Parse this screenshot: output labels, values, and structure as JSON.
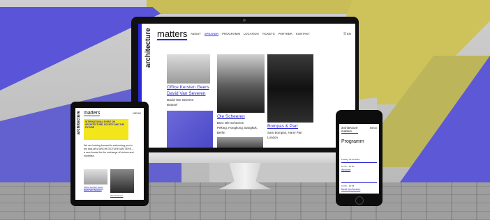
{
  "desktop": {
    "brand_vertical": "architecture",
    "brand_main": "matters",
    "nav": [
      "ABOUT",
      "SPEAKER",
      "PROGRAMM",
      "LOCATION",
      "TICKETS",
      "PARTNER",
      "KONTAKT"
    ],
    "nav_active_index": 1,
    "nav_right": "☰ EN",
    "cards": [
      {
        "title1": "Office Kersten Geers",
        "title2": "David Van Severen",
        "line1": "David Van Severen",
        "line2": "Brüssel"
      },
      {
        "title1": "Ole Scheeren",
        "line1": "Büro Ole Scheeren",
        "line2": "Peking, Hongkong, Bangkok,",
        "line3": "Berlin"
      },
      {
        "title1": "Bompas & Parr",
        "line1": "Sam Bompas, Harry Parr",
        "line2": "London"
      }
    ]
  },
  "tablet": {
    "brand_vertical": "architecture",
    "brand_main": "matters",
    "menu": "MENÜ",
    "banner": "INTERNATIONAL EVENT ON ARCHITECTURE, SOCIETY AND THE FUTURE",
    "text": "We are looking forward to welcoming you to the kick-off of ARCHITECTURE MATTERS – a new format for the exchange of visions and expertise.",
    "caption1": "Office Kersten Geers David Van Severen",
    "caption2": "Ole Scheeren"
  },
  "phone": {
    "brand_top": "architecture",
    "brand_bottom": "matters",
    "menu": "MENÜ",
    "title": "Programm",
    "date": "Freitag, 15.03.2019",
    "time1": "10:15 – 10:30",
    "event1": "Welcome",
    "time2": "10:30 – 10:45",
    "event2": "David Van Severen"
  },
  "colors": {
    "accent": "#2b2ad4",
    "yellow": "#f2e51c",
    "wall_blue": "#5a55d8",
    "wall_yellow": "#cdc35a"
  }
}
